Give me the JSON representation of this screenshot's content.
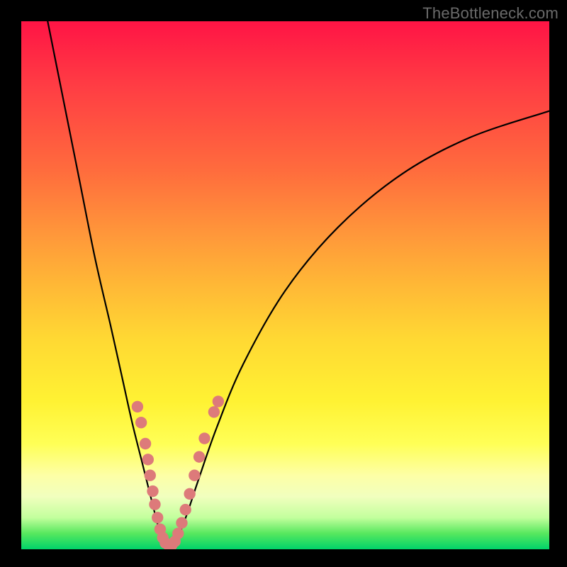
{
  "watermark": "TheBottleneck.com",
  "chart_data": {
    "type": "line",
    "title": "",
    "xlabel": "",
    "ylabel": "",
    "xlim": [
      0,
      100
    ],
    "ylim": [
      0,
      100
    ],
    "grid": false,
    "legend": false,
    "series": [
      {
        "name": "left-branch",
        "x": [
          5,
          8,
          11,
          14,
          17,
          19,
          21,
          23,
          24.5,
          25.5,
          26.3,
          27
        ],
        "y": [
          100,
          85,
          70,
          55,
          42,
          33,
          24,
          16,
          10,
          6,
          3,
          0.5
        ]
      },
      {
        "name": "right-branch",
        "x": [
          29,
          30,
          31.5,
          33.5,
          37,
          42,
          50,
          60,
          72,
          85,
          100
        ],
        "y": [
          0.5,
          3,
          7,
          13,
          23,
          35,
          49,
          61,
          71,
          78,
          83
        ]
      }
    ],
    "markers": {
      "name": "highlight-dots",
      "color": "#dd7a7a",
      "radius_rel": 1.1,
      "points": [
        {
          "x": 22.0,
          "y": 27
        },
        {
          "x": 22.7,
          "y": 24
        },
        {
          "x": 23.5,
          "y": 20
        },
        {
          "x": 24.0,
          "y": 17
        },
        {
          "x": 24.4,
          "y": 14
        },
        {
          "x": 24.9,
          "y": 11
        },
        {
          "x": 25.3,
          "y": 8.5
        },
        {
          "x": 25.8,
          "y": 6
        },
        {
          "x": 26.3,
          "y": 3.8
        },
        {
          "x": 26.8,
          "y": 2.2
        },
        {
          "x": 27.3,
          "y": 1.2
        },
        {
          "x": 27.9,
          "y": 0.8
        },
        {
          "x": 28.5,
          "y": 0.8
        },
        {
          "x": 29.1,
          "y": 1.5
        },
        {
          "x": 29.7,
          "y": 3
        },
        {
          "x": 30.4,
          "y": 5
        },
        {
          "x": 31.1,
          "y": 7.5
        },
        {
          "x": 31.9,
          "y": 10.5
        },
        {
          "x": 32.8,
          "y": 14
        },
        {
          "x": 33.7,
          "y": 17.5
        },
        {
          "x": 34.7,
          "y": 21
        },
        {
          "x": 36.5,
          "y": 26
        },
        {
          "x": 37.3,
          "y": 28
        }
      ]
    },
    "gradient_stops": [
      {
        "pos": 0.0,
        "color": "#ff1445"
      },
      {
        "pos": 0.5,
        "color": "#ffb836"
      },
      {
        "pos": 0.8,
        "color": "#ffff56"
      },
      {
        "pos": 1.0,
        "color": "#00d36a"
      }
    ]
  }
}
